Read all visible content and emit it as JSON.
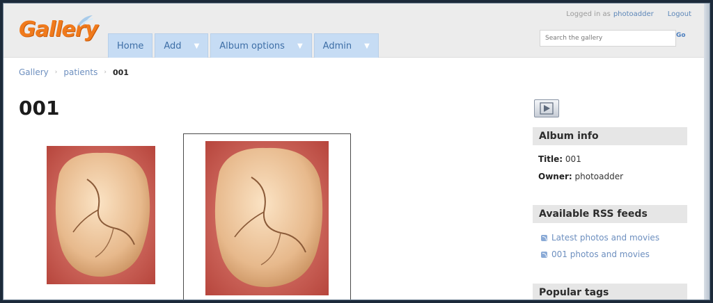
{
  "header": {
    "logo": "Gallery",
    "logged_in_prefix": "Logged in as",
    "username": "photoadder",
    "logout": "Logout",
    "search_placeholder": "Search the gallery",
    "search_go": "Go"
  },
  "nav": {
    "items": [
      {
        "label": "Home",
        "has_caret": false
      },
      {
        "label": "Add",
        "has_caret": true
      },
      {
        "label": "Album options",
        "has_caret": true
      },
      {
        "label": "Admin",
        "has_caret": true
      }
    ]
  },
  "breadcrumb": {
    "items": [
      "Gallery",
      "patients"
    ],
    "current": "001",
    "separator": "›"
  },
  "main": {
    "title": "001"
  },
  "sidebar": {
    "album_info_heading": "Album info",
    "title_label": "Title:",
    "title_value": "001",
    "owner_label": "Owner:",
    "owner_value": "photoadder",
    "rss_heading": "Available RSS feeds",
    "rss_links": [
      "Latest photos and movies",
      "001 photos and movies"
    ],
    "popular_tags_heading": "Popular tags"
  },
  "colors": {
    "nav_bg": "#c6dcf4",
    "link": "#6d8fbf",
    "logo": "#f07a1c"
  }
}
